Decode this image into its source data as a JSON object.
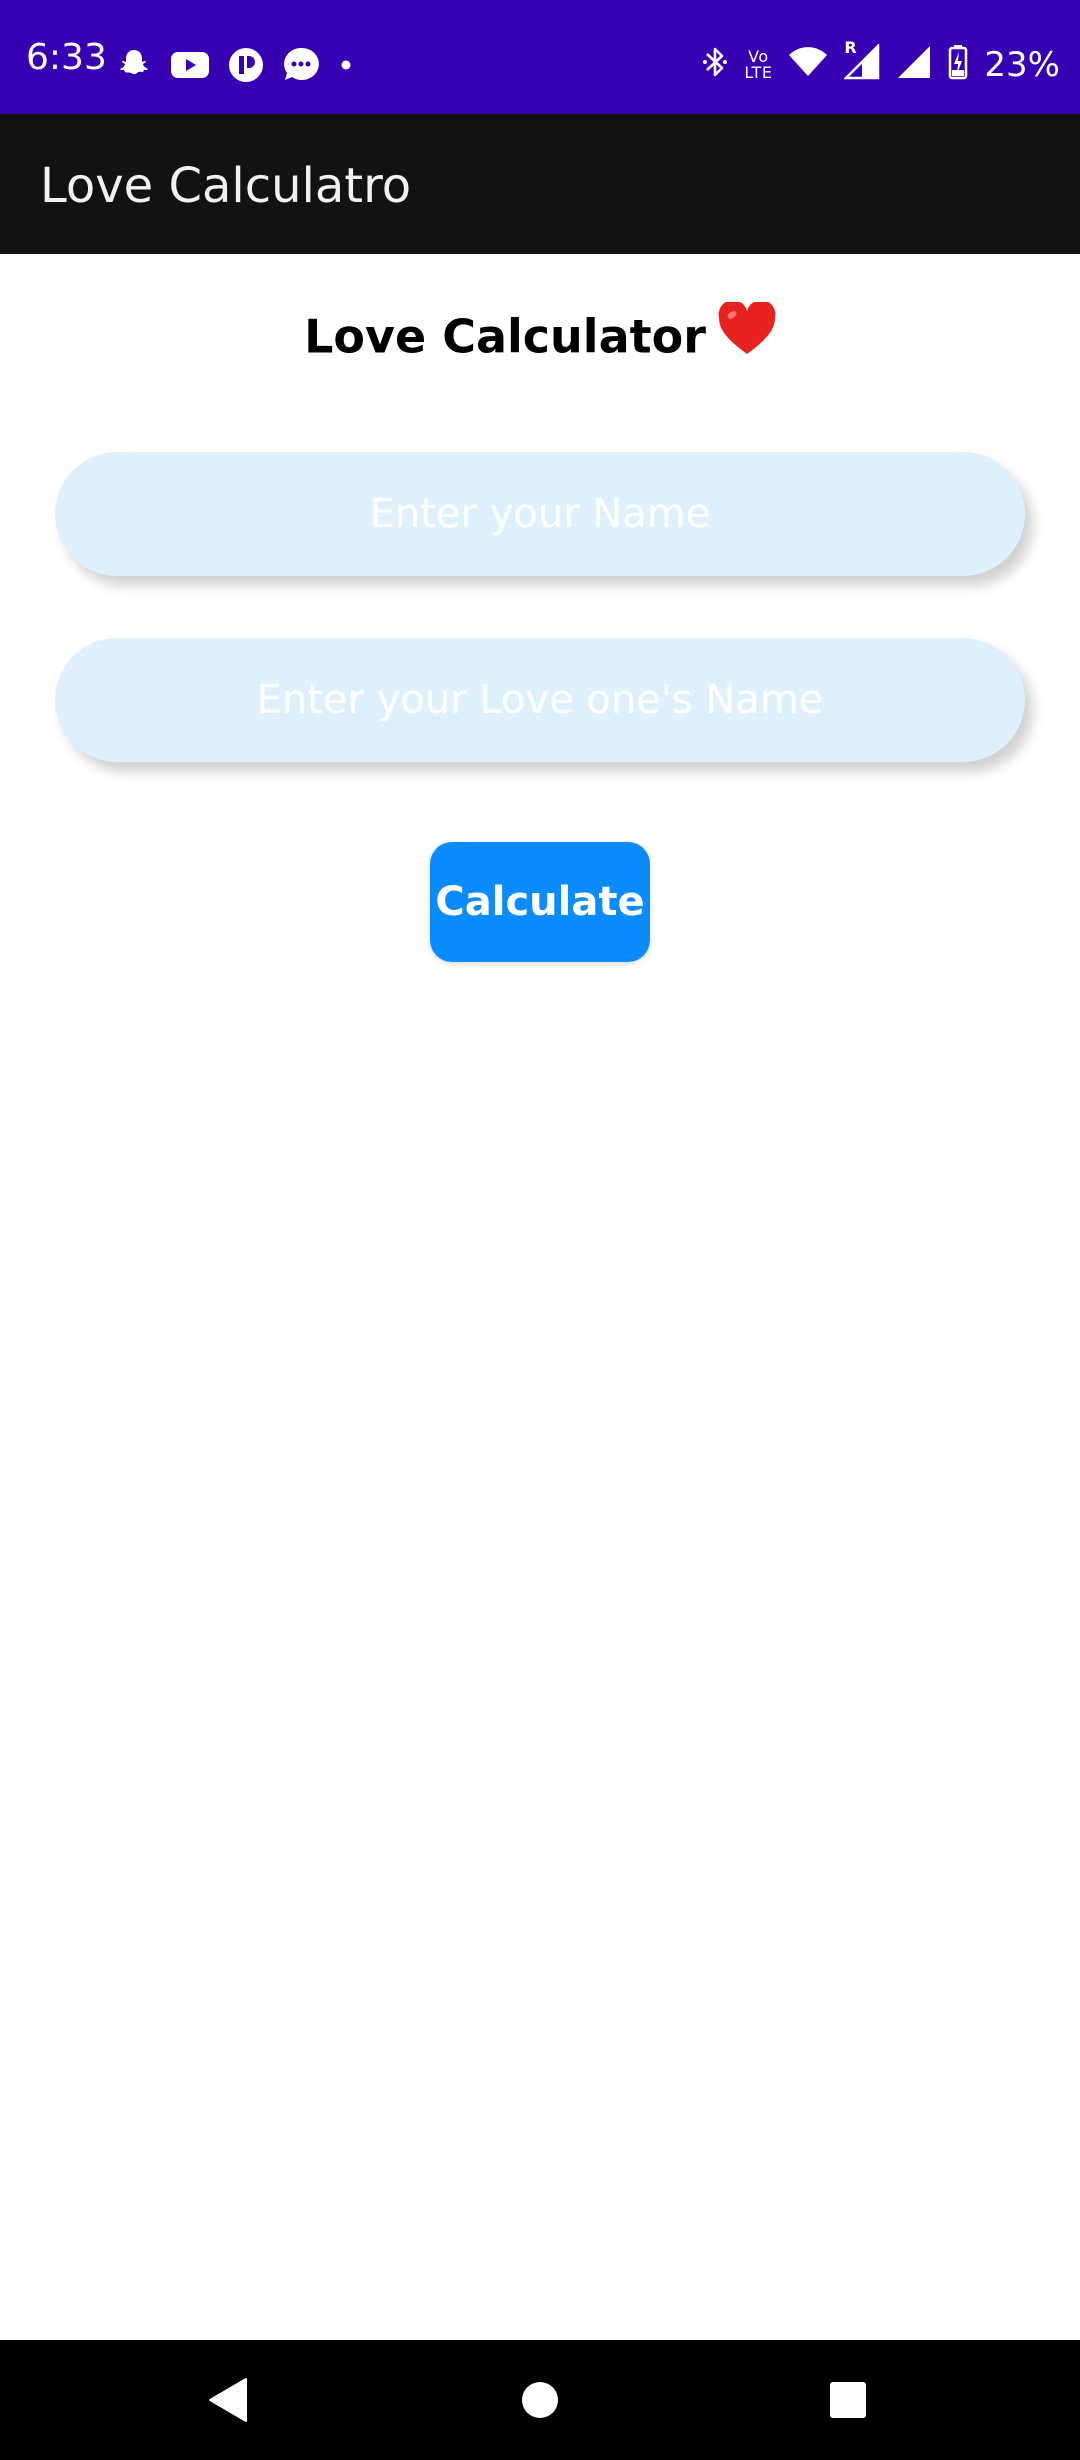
{
  "status_bar": {
    "time": "6:33",
    "battery": "23%",
    "network_label_top": "Vo",
    "network_label_bottom": "LTE",
    "roaming_label": "R",
    "background_color": "#3700b3",
    "left_icons": [
      "snapchat-icon",
      "youtube-icon",
      "app-icon",
      "messages-icon",
      "dot-icon"
    ],
    "right_icons": [
      "bluetooth-icon",
      "volte-icon",
      "wifi-icon",
      "signal-roaming-icon",
      "signal-icon",
      "battery-charging-icon"
    ]
  },
  "app_bar": {
    "title": "Love Calculatro",
    "background_color": "#121212"
  },
  "main": {
    "heading": "Love Calculator",
    "heading_emoji": "heart-icon",
    "name_input": {
      "placeholder": "Enter your Name",
      "value": ""
    },
    "love_name_input": {
      "placeholder": "Enter your Love one's Name",
      "value": ""
    },
    "calculate_button_label": "Calculate",
    "input_background_color": "#dff0fd",
    "button_color": "#0a8cff"
  },
  "nav_bar": {
    "icons": [
      "back-icon",
      "home-icon",
      "recents-icon"
    ]
  }
}
